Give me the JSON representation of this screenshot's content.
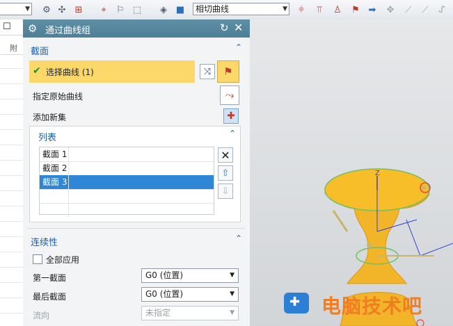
{
  "toolbar": {
    "curve_rule_value": "相切曲线",
    "icons": [
      "snap-icon",
      "point-icon",
      "select-box-icon",
      "intersection-icon",
      "filter-icon",
      "rect-select-icon",
      "solid-icon",
      "view-cube-icon",
      "arrow-icon",
      "tangent-icon",
      "parallel-icon",
      "measure-icon",
      "arrow-right-icon",
      "scatter-icon",
      "line-icon",
      "curve-icon"
    ]
  },
  "dialog": {
    "title": "通过曲线组",
    "section": {
      "header": "截面",
      "select_curve_label": "选择曲线 (1)",
      "specify_origin_label": "指定原始曲线",
      "add_new_set_label": "添加新集"
    },
    "list": {
      "header": "列表",
      "rows": [
        "截面 1",
        "截面 2",
        "截面 3"
      ],
      "selected_index": 2
    },
    "continuity": {
      "header": "连续性",
      "apply_all_label": "全部应用",
      "apply_all_checked": false,
      "first_section_label": "第一截面",
      "first_section_value": "G0 (位置)",
      "last_section_label": "最后截面",
      "last_section_value": "G0 (位置)",
      "flow_label": "流向",
      "flow_value": "未指定"
    }
  },
  "left_strip": {
    "header_text": "附"
  },
  "viewport": {
    "axis_label": "Z"
  },
  "watermark": {
    "text": "电脑技术吧"
  },
  "colors": {
    "title_bar": "#55879d",
    "selected_row": "#2f86d6",
    "highlight": "#fcd86a",
    "surface": "#f2b529"
  }
}
